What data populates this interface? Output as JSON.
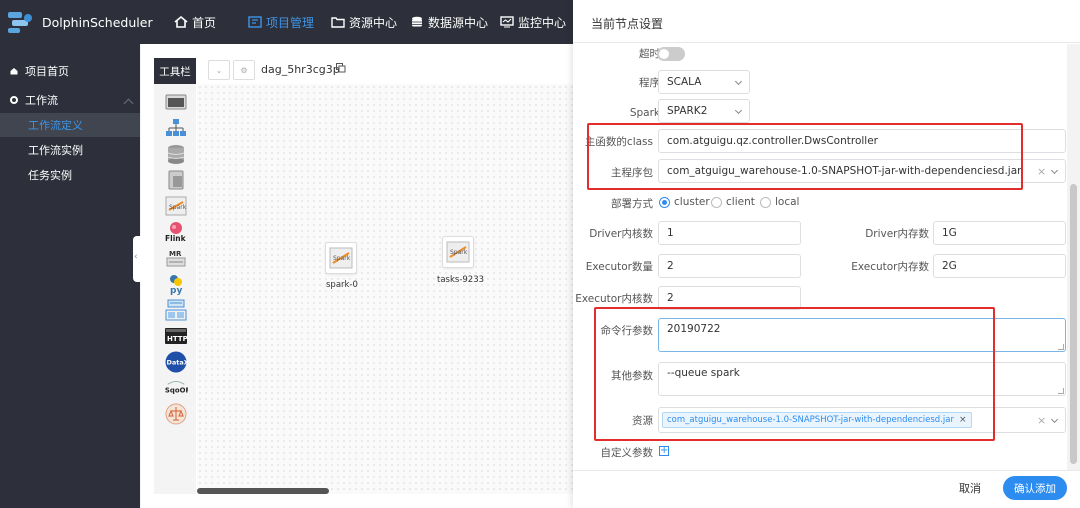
{
  "app": {
    "name": "DolphinScheduler"
  },
  "nav": [
    {
      "label": "首页",
      "icon": "home-icon"
    },
    {
      "label": "项目管理",
      "icon": "project-icon",
      "active": true
    },
    {
      "label": "资源中心",
      "icon": "folder-icon"
    },
    {
      "label": "数据源中心",
      "icon": "database-icon"
    },
    {
      "label": "监控中心",
      "icon": "monitor-icon"
    }
  ],
  "sidebar": {
    "items": [
      {
        "label": "项目首页",
        "icon": "home-icon"
      },
      {
        "label": "工作流",
        "icon": "gear-icon"
      },
      {
        "label": "工作流定义",
        "active": true
      },
      {
        "label": "工作流实例"
      },
      {
        "label": "任务实例"
      }
    ]
  },
  "canvas": {
    "toolbar_label": "工具栏",
    "dag_name": "dag_5hr3cg3p",
    "nodes": [
      {
        "label": "spark-0",
        "icon": "spark-icon"
      },
      {
        "label": "tasks-9233",
        "icon": "spark-icon"
      }
    ],
    "tools": [
      "shell-icon",
      "sub-process-icon",
      "procedure-icon",
      "sql-icon",
      "spark-icon",
      "flink-icon",
      "mr-icon",
      "python-icon",
      "dependent-icon",
      "http-icon",
      "datax-icon",
      "sqoop-icon",
      "conditions-icon"
    ],
    "tool_texts": {
      "spark": "Spark",
      "flink": "Flink",
      "mr": "MR",
      "python": "py",
      "http": "HTTP",
      "datax": "DataX",
      "sqoop": "SqoOP"
    }
  },
  "drawer": {
    "title": "当前节点设置",
    "timeout_alarm_label": "超时告警",
    "program_type_label": "程序类型",
    "program_type": "SCALA",
    "spark_version_label": "Spark版本",
    "spark_version": "SPARK2",
    "main_class_label": "主函数的class",
    "main_class": "com.atguigu.qz.controller.DwsController",
    "main_jar_label": "主程序包",
    "main_jar": "com_atguigu_warehouse-1.0-SNAPSHOT-jar-with-dependenciesd.jar",
    "deploy_mode_label": "部署方式",
    "deploy_modes": [
      "cluster",
      "client",
      "local"
    ],
    "driver_cores_label": "Driver内核数",
    "driver_cores": "1",
    "driver_memory_label": "Driver内存数",
    "driver_memory": "1G",
    "executor_num_label": "Executor数量",
    "executor_num": "2",
    "executor_memory_label": "Executor内存数",
    "executor_memory": "2G",
    "executor_cores_label": "Executor内核数",
    "executor_cores": "2",
    "args_label": "命令行参数",
    "args": "20190722",
    "others_label": "其他参数",
    "others": "--queue spark",
    "resources_label": "资源",
    "resource_tag": "com_atguigu_warehouse-1.0-SNAPSHOT-jar-with-dependenciesd.jar",
    "custom_params_label": "自定义参数",
    "cancel": "取消",
    "confirm": "确认添加"
  },
  "colors": {
    "topbar": "#2d303a",
    "accent": "#2d8cf0",
    "highlight": "#e32d2d"
  }
}
